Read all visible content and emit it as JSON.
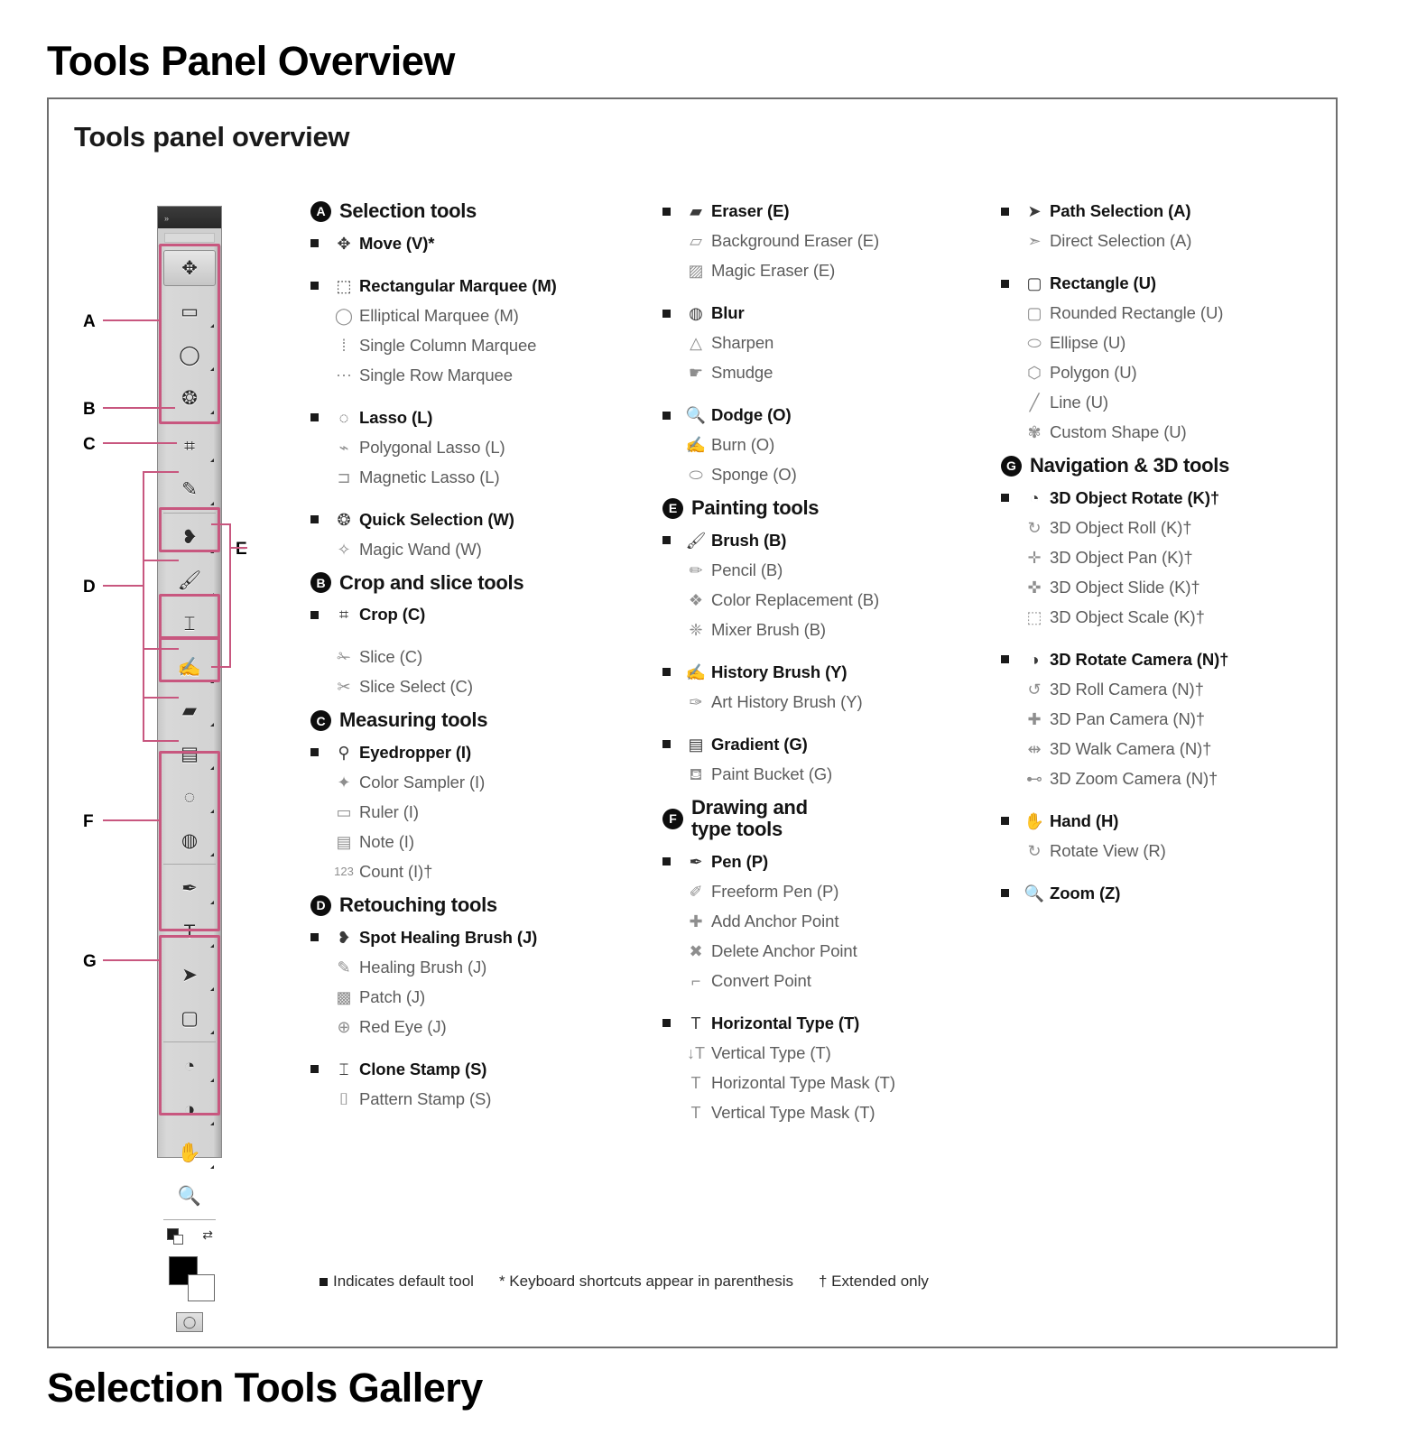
{
  "document": {
    "heading_top": "Tools Panel Overview",
    "heading_bottom": "Selection Tools Gallery",
    "cut_text": ""
  },
  "figure": {
    "title": "Tools panel overview",
    "legend": {
      "default_tool": "Indicates default tool",
      "shortcuts": "* Keyboard shortcuts appear in parenthesis",
      "extended": "† Extended only"
    }
  },
  "palette": {
    "callouts": [
      "A",
      "B",
      "C",
      "D",
      "E",
      "F",
      "G"
    ],
    "slots": [
      {
        "name": "move-tool",
        "glyph": "✥",
        "selected": true,
        "corner": false
      },
      {
        "name": "rectangular-marquee-tool",
        "glyph": "▭",
        "selected": false,
        "corner": true
      },
      {
        "name": "lasso-tool",
        "glyph": "◯",
        "selected": false,
        "corner": true
      },
      {
        "name": "quick-selection-tool",
        "glyph": "❂",
        "selected": false,
        "corner": true
      },
      {
        "name": "crop-tool",
        "glyph": "⌗",
        "selected": false,
        "corner": true
      },
      {
        "name": "eyedropper-tool",
        "glyph": "✎",
        "selected": false,
        "corner": true
      },
      {
        "name": "spot-healing-brush-tool",
        "glyph": "❥",
        "selected": false,
        "corner": true
      },
      {
        "name": "brush-tool",
        "glyph": "🖌",
        "selected": false,
        "corner": true
      },
      {
        "name": "clone-stamp-tool",
        "glyph": "⌶",
        "selected": false,
        "corner": true
      },
      {
        "name": "history-brush-tool",
        "glyph": "✍",
        "selected": false,
        "corner": true
      },
      {
        "name": "eraser-tool",
        "glyph": "▰",
        "selected": false,
        "corner": true
      },
      {
        "name": "gradient-tool",
        "glyph": "▤",
        "selected": false,
        "corner": true
      },
      {
        "name": "blur-tool",
        "glyph": "◌",
        "selected": false,
        "corner": true
      },
      {
        "name": "dodge-tool",
        "glyph": "◍",
        "selected": false,
        "corner": true
      },
      {
        "name": "pen-tool",
        "glyph": "✒",
        "selected": false,
        "corner": true
      },
      {
        "name": "horizontal-type-tool",
        "glyph": "T",
        "selected": false,
        "corner": true
      },
      {
        "name": "path-selection-tool",
        "glyph": "➤",
        "selected": false,
        "corner": true
      },
      {
        "name": "rectangle-tool",
        "glyph": "▢",
        "selected": false,
        "corner": true
      },
      {
        "name": "3d-object-rotate-tool",
        "glyph": "◔",
        "selected": false,
        "corner": true
      },
      {
        "name": "3d-rotate-camera-tool",
        "glyph": "◑",
        "selected": false,
        "corner": true
      },
      {
        "name": "hand-tool",
        "glyph": "✋",
        "selected": false,
        "corner": true
      },
      {
        "name": "zoom-tool",
        "glyph": "🔍",
        "selected": false,
        "corner": false
      }
    ]
  },
  "columns": [
    {
      "groups": [
        {
          "letter": "A",
          "title": "Selection tools",
          "tools": [
            {
              "label": "Move  (V)*",
              "primary": true,
              "bullet": true,
              "icon": "move-icon"
            },
            {
              "spacer": true
            },
            {
              "label": "Rectangular Marquee  (M)",
              "primary": true,
              "bullet": true,
              "icon": "rectangular-marquee-icon"
            },
            {
              "label": "Elliptical Marquee  (M)",
              "primary": false,
              "bullet": false,
              "icon": "elliptical-marquee-icon"
            },
            {
              "label": "Single Column Marquee",
              "primary": false,
              "bullet": false,
              "icon": "single-column-marquee-icon"
            },
            {
              "label": "Single Row Marquee",
              "primary": false,
              "bullet": false,
              "icon": "single-row-marquee-icon"
            },
            {
              "spacer": true
            },
            {
              "label": "Lasso  (L)",
              "primary": true,
              "bullet": true,
              "icon": "lasso-icon"
            },
            {
              "label": "Polygonal Lasso  (L)",
              "primary": false,
              "bullet": false,
              "icon": "polygonal-lasso-icon"
            },
            {
              "label": "Magnetic Lasso  (L)",
              "primary": false,
              "bullet": false,
              "icon": "magnetic-lasso-icon"
            },
            {
              "spacer": true
            },
            {
              "label": "Quick Selection (W)",
              "primary": true,
              "bullet": true,
              "icon": "quick-selection-icon"
            },
            {
              "label": "Magic Wand  (W)",
              "primary": false,
              "bullet": false,
              "icon": "magic-wand-icon"
            }
          ]
        },
        {
          "letter": "B",
          "title": "Crop and slice tools",
          "tools": [
            {
              "label": "Crop  (C)",
              "primary": true,
              "bullet": true,
              "icon": "crop-icon"
            },
            {
              "spacer": true
            },
            {
              "label": "Slice  (C)",
              "primary": false,
              "bullet": false,
              "icon": "slice-icon"
            },
            {
              "label": "Slice Select  (C)",
              "primary": false,
              "bullet": false,
              "icon": "slice-select-icon"
            }
          ]
        },
        {
          "letter": "C",
          "title": "Measuring tools",
          "tools": [
            {
              "label": "Eyedropper  (I)",
              "primary": true,
              "bullet": true,
              "icon": "eyedropper-icon"
            },
            {
              "label": "Color Sampler  (I)",
              "primary": false,
              "bullet": false,
              "icon": "color-sampler-icon"
            },
            {
              "label": "Ruler  (I)",
              "primary": false,
              "bullet": false,
              "icon": "ruler-icon"
            },
            {
              "label": "Note  (I)",
              "primary": false,
              "bullet": false,
              "icon": "note-icon"
            },
            {
              "label": "Count  (I)†",
              "primary": false,
              "bullet": false,
              "icon": "count-icon"
            }
          ]
        },
        {
          "letter": "D",
          "title": "Retouching tools",
          "tools": [
            {
              "label": "Spot Healing Brush  (J)",
              "primary": true,
              "bullet": true,
              "icon": "spot-healing-brush-icon"
            },
            {
              "label": "Healing Brush  (J)",
              "primary": false,
              "bullet": false,
              "icon": "healing-brush-icon"
            },
            {
              "label": "Patch  (J)",
              "primary": false,
              "bullet": false,
              "icon": "patch-icon"
            },
            {
              "label": "Red Eye  (J)",
              "primary": false,
              "bullet": false,
              "icon": "red-eye-icon"
            },
            {
              "spacer": true
            },
            {
              "label": "Clone Stamp  (S)",
              "primary": true,
              "bullet": true,
              "icon": "clone-stamp-icon"
            },
            {
              "label": "Pattern Stamp  (S)",
              "primary": false,
              "bullet": false,
              "icon": "pattern-stamp-icon"
            }
          ]
        }
      ]
    },
    {
      "groups": [
        {
          "letter": "",
          "title": "",
          "tools": [
            {
              "label": "Eraser  (E)",
              "primary": true,
              "bullet": true,
              "icon": "eraser-icon"
            },
            {
              "label": "Background Eraser  (E)",
              "primary": false,
              "bullet": false,
              "icon": "background-eraser-icon"
            },
            {
              "label": "Magic Eraser  (E)",
              "primary": false,
              "bullet": false,
              "icon": "magic-eraser-icon"
            },
            {
              "spacer": true
            },
            {
              "label": "Blur",
              "primary": true,
              "bullet": true,
              "icon": "blur-icon"
            },
            {
              "label": "Sharpen",
              "primary": false,
              "bullet": false,
              "icon": "sharpen-icon"
            },
            {
              "label": "Smudge",
              "primary": false,
              "bullet": false,
              "icon": "smudge-icon"
            },
            {
              "spacer": true
            },
            {
              "label": "Dodge  (O)",
              "primary": true,
              "bullet": true,
              "icon": "dodge-icon"
            },
            {
              "label": "Burn  (O)",
              "primary": false,
              "bullet": false,
              "icon": "burn-icon"
            },
            {
              "label": "Sponge  (O)",
              "primary": false,
              "bullet": false,
              "icon": "sponge-icon"
            }
          ]
        },
        {
          "letter": "E",
          "title": "Painting tools",
          "tools": [
            {
              "label": "Brush  (B)",
              "primary": true,
              "bullet": true,
              "icon": "brush-icon"
            },
            {
              "label": "Pencil  (B)",
              "primary": false,
              "bullet": false,
              "icon": "pencil-icon"
            },
            {
              "label": "Color Replacement  (B)",
              "primary": false,
              "bullet": false,
              "icon": "color-replacement-icon"
            },
            {
              "label": "Mixer Brush  (B)",
              "primary": false,
              "bullet": false,
              "icon": "mixer-brush-icon"
            },
            {
              "spacer": true
            },
            {
              "label": "History Brush  (Y)",
              "primary": true,
              "bullet": true,
              "icon": "history-brush-icon"
            },
            {
              "label": "Art History Brush  (Y)",
              "primary": false,
              "bullet": false,
              "icon": "art-history-brush-icon"
            },
            {
              "spacer": true
            },
            {
              "label": "Gradient  (G)",
              "primary": true,
              "bullet": true,
              "icon": "gradient-icon"
            },
            {
              "label": "Paint Bucket  (G)",
              "primary": false,
              "bullet": false,
              "icon": "paint-bucket-icon"
            }
          ]
        },
        {
          "letter": "F",
          "title": "Drawing and\ntype tools",
          "tools": [
            {
              "label": "Pen  (P)",
              "primary": true,
              "bullet": true,
              "icon": "pen-icon"
            },
            {
              "label": "Freeform Pen  (P)",
              "primary": false,
              "bullet": false,
              "icon": "freeform-pen-icon"
            },
            {
              "label": "Add Anchor Point",
              "primary": false,
              "bullet": false,
              "icon": "add-anchor-point-icon"
            },
            {
              "label": "Delete Anchor  Point",
              "primary": false,
              "bullet": false,
              "icon": "delete-anchor-point-icon"
            },
            {
              "label": "Convert Point",
              "primary": false,
              "bullet": false,
              "icon": "convert-point-icon"
            },
            {
              "spacer": true
            },
            {
              "label": "Horizontal Type  (T)",
              "primary": true,
              "bullet": true,
              "icon": "horizontal-type-icon"
            },
            {
              "label": "Vertical Type  (T)",
              "primary": false,
              "bullet": false,
              "icon": "vertical-type-icon"
            },
            {
              "label": "Horizontal Type Mask  (T)",
              "primary": false,
              "bullet": false,
              "icon": "horizontal-type-mask-icon"
            },
            {
              "label": "Vertical Type Mask  (T)",
              "primary": false,
              "bullet": false,
              "icon": "vertical-type-mask-icon"
            }
          ]
        }
      ]
    },
    {
      "groups": [
        {
          "letter": "",
          "title": "",
          "tools": [
            {
              "label": "Path Selection  (A)",
              "primary": true,
              "bullet": true,
              "icon": "path-selection-icon"
            },
            {
              "label": "Direct Selection  (A)",
              "primary": false,
              "bullet": false,
              "icon": "direct-selection-icon"
            },
            {
              "spacer": true
            },
            {
              "label": "Rectangle  (U)",
              "primary": true,
              "bullet": true,
              "icon": "rectangle-icon"
            },
            {
              "label": "Rounded Rectangle  (U)",
              "primary": false,
              "bullet": false,
              "icon": "rounded-rectangle-icon"
            },
            {
              "label": "Ellipse  (U)",
              "primary": false,
              "bullet": false,
              "icon": "ellipse-icon"
            },
            {
              "label": "Polygon  (U)",
              "primary": false,
              "bullet": false,
              "icon": "polygon-icon"
            },
            {
              "label": "Line  (U)",
              "primary": false,
              "bullet": false,
              "icon": "line-icon"
            },
            {
              "label": "Custom Shape  (U)",
              "primary": false,
              "bullet": false,
              "icon": "custom-shape-icon"
            }
          ]
        },
        {
          "letter": "G",
          "title": "Navigation & 3D tools",
          "tools": [
            {
              "label": "3D Object Rotate  (K)†",
              "primary": true,
              "bullet": true,
              "icon": "3d-object-rotate-icon"
            },
            {
              "label": "3D Object Roll  (K)†",
              "primary": false,
              "bullet": false,
              "icon": "3d-object-roll-icon"
            },
            {
              "label": "3D Object Pan  (K)†",
              "primary": false,
              "bullet": false,
              "icon": "3d-object-pan-icon"
            },
            {
              "label": "3D Object Slide  (K)†",
              "primary": false,
              "bullet": false,
              "icon": "3d-object-slide-icon"
            },
            {
              "label": "3D Object Scale  (K)†",
              "primary": false,
              "bullet": false,
              "icon": "3d-object-scale-icon"
            },
            {
              "spacer": true
            },
            {
              "label": "3D Rotate Camera  (N)†",
              "primary": true,
              "bullet": true,
              "icon": "3d-rotate-camera-icon"
            },
            {
              "label": "3D Roll Camera  (N)†",
              "primary": false,
              "bullet": false,
              "icon": "3d-roll-camera-icon"
            },
            {
              "label": "3D Pan Camera  (N)†",
              "primary": false,
              "bullet": false,
              "icon": "3d-pan-camera-icon"
            },
            {
              "label": "3D Walk Camera  (N)†",
              "primary": false,
              "bullet": false,
              "icon": "3d-walk-camera-icon"
            },
            {
              "label": "3D Zoom Camera  (N)†",
              "primary": false,
              "bullet": false,
              "icon": "3d-zoom-camera-icon"
            },
            {
              "spacer": true
            },
            {
              "label": "Hand  (H)",
              "primary": true,
              "bullet": true,
              "icon": "hand-icon"
            },
            {
              "label": "Rotate View  (R)",
              "primary": false,
              "bullet": false,
              "icon": "rotate-view-icon"
            },
            {
              "spacer": true
            },
            {
              "label": "Zoom  (Z)",
              "primary": true,
              "bullet": true,
              "icon": "zoom-icon"
            }
          ]
        }
      ]
    }
  ],
  "colors": {
    "callout_magenta": "#c8577f",
    "frame_gray": "#6e6e6e",
    "sub_label_gray": "#5c5c5c"
  }
}
